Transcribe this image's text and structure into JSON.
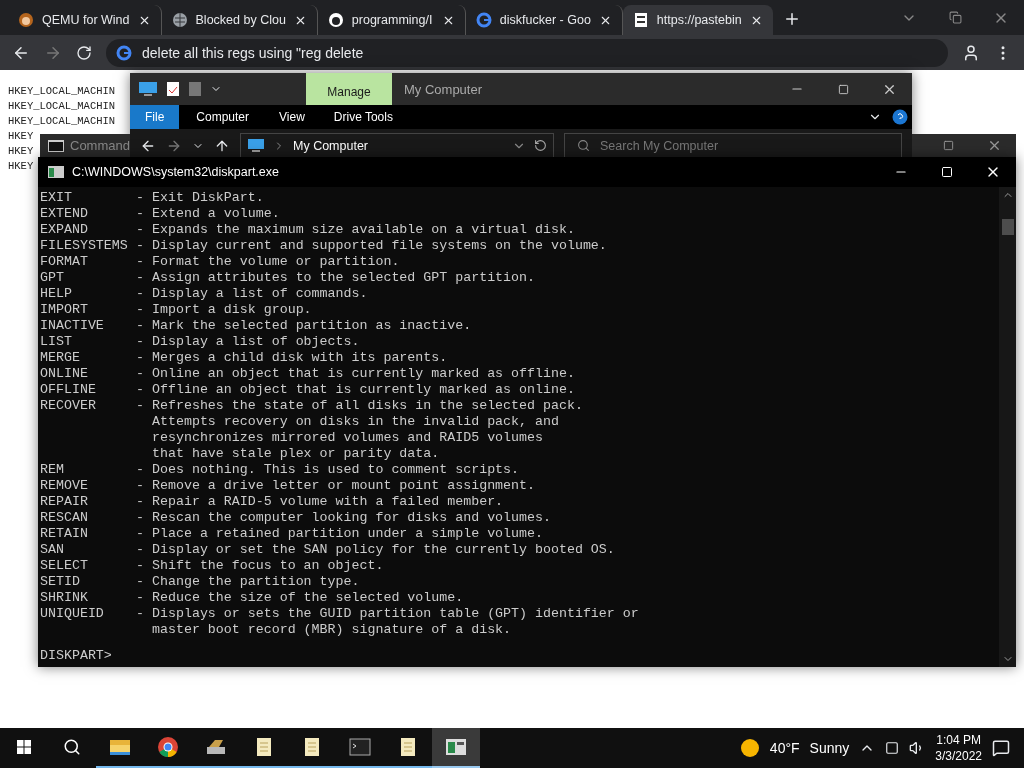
{
  "browser": {
    "tabs": [
      {
        "title": "QEMU for Wind",
        "selected": false
      },
      {
        "title": "Blocked by Clou",
        "selected": false
      },
      {
        "title": "programming/I",
        "selected": false
      },
      {
        "title": "diskfucker - Goo",
        "selected": false
      },
      {
        "title": "https://pastebin",
        "selected": true
      }
    ],
    "address": "delete all this regs using \"reg delete",
    "page_lines": [
      "HKEY_LOCAL_MACHIN",
      "HKEY_LOCAL_MACHIN",
      "HKEY_LOCAL_MACHIN",
      "HKEY",
      "HKEY",
      "HKEY"
    ]
  },
  "explorer": {
    "context_tab": "Manage",
    "title": "My Computer",
    "ribbon_tabs": [
      {
        "label": "File",
        "selected": true
      },
      {
        "label": "Computer",
        "selected": false
      },
      {
        "label": "View",
        "selected": false
      },
      {
        "label": "Drive Tools",
        "selected": false
      }
    ],
    "path": "My Computer",
    "search_placeholder": "Search My Computer"
  },
  "command_window": {
    "title": "Command"
  },
  "diskpart": {
    "title": "C:\\WINDOWS\\system32\\diskpart.exe",
    "entries": [
      {
        "command": "EXIT",
        "dash": "-",
        "description": [
          "Exit DiskPart."
        ]
      },
      {
        "command": "EXTEND",
        "dash": "-",
        "description": [
          "Extend a volume."
        ]
      },
      {
        "command": "EXPAND",
        "dash": "-",
        "description": [
          "Expands the maximum size available on a virtual disk."
        ]
      },
      {
        "command": "FILESYSTEMS",
        "dash": "-",
        "description": [
          "Display current and supported file systems on the volume."
        ]
      },
      {
        "command": "FORMAT",
        "dash": "-",
        "description": [
          "Format the volume or partition."
        ]
      },
      {
        "command": "GPT",
        "dash": "-",
        "description": [
          "Assign attributes to the selected GPT partition."
        ]
      },
      {
        "command": "HELP",
        "dash": "-",
        "description": [
          "Display a list of commands."
        ]
      },
      {
        "command": "IMPORT",
        "dash": "-",
        "description": [
          "Import a disk group."
        ]
      },
      {
        "command": "INACTIVE",
        "dash": "-",
        "description": [
          "Mark the selected partition as inactive."
        ]
      },
      {
        "command": "LIST",
        "dash": "-",
        "description": [
          "Display a list of objects."
        ]
      },
      {
        "command": "MERGE",
        "dash": "-",
        "description": [
          "Merges a child disk with its parents."
        ]
      },
      {
        "command": "ONLINE",
        "dash": "-",
        "description": [
          "Online an object that is currently marked as offline."
        ]
      },
      {
        "command": "OFFLINE",
        "dash": "-",
        "description": [
          "Offline an object that is currently marked as online."
        ]
      },
      {
        "command": "RECOVER",
        "dash": "-",
        "description": [
          "Refreshes the state of all disks in the selected pack.",
          "Attempts recovery on disks in the invalid pack, and",
          "resynchronizes mirrored volumes and RAID5 volumes",
          "that have stale plex or parity data."
        ]
      },
      {
        "command": "REM",
        "dash": "-",
        "description": [
          "Does nothing. This is used to comment scripts."
        ]
      },
      {
        "command": "REMOVE",
        "dash": "-",
        "description": [
          "Remove a drive letter or mount point assignment."
        ]
      },
      {
        "command": "REPAIR",
        "dash": "-",
        "description": [
          "Repair a RAID-5 volume with a failed member."
        ]
      },
      {
        "command": "RESCAN",
        "dash": "-",
        "description": [
          "Rescan the computer looking for disks and volumes."
        ]
      },
      {
        "command": "RETAIN",
        "dash": "-",
        "description": [
          "Place a retained partition under a simple volume."
        ]
      },
      {
        "command": "SAN",
        "dash": "-",
        "description": [
          "Display or set the SAN policy for the currently booted OS."
        ]
      },
      {
        "command": "SELECT",
        "dash": "-",
        "description": [
          "Shift the focus to an object."
        ]
      },
      {
        "command": "SETID",
        "dash": "-",
        "description": [
          "Change the partition type."
        ]
      },
      {
        "command": "SHRINK",
        "dash": "-",
        "description": [
          "Reduce the size of the selected volume."
        ]
      },
      {
        "command": "UNIQUEID",
        "dash": "-",
        "description": [
          "Displays or sets the GUID partition table (GPT) identifier or",
          "master boot record (MBR) signature of a disk."
        ]
      }
    ],
    "prompt": "DISKPART>"
  },
  "taskbar": {
    "apps": [
      {
        "running": true,
        "active": false
      },
      {
        "running": true,
        "active": false
      },
      {
        "running": true,
        "active": false
      },
      {
        "running": true,
        "active": false
      },
      {
        "running": true,
        "active": false
      },
      {
        "running": true,
        "active": false
      },
      {
        "running": true,
        "active": false
      },
      {
        "running": true,
        "active": true
      }
    ],
    "weather": {
      "temperature": "40°F",
      "condition": "Sunny"
    },
    "time": "1:04 PM",
    "date": "3/3/2022"
  }
}
